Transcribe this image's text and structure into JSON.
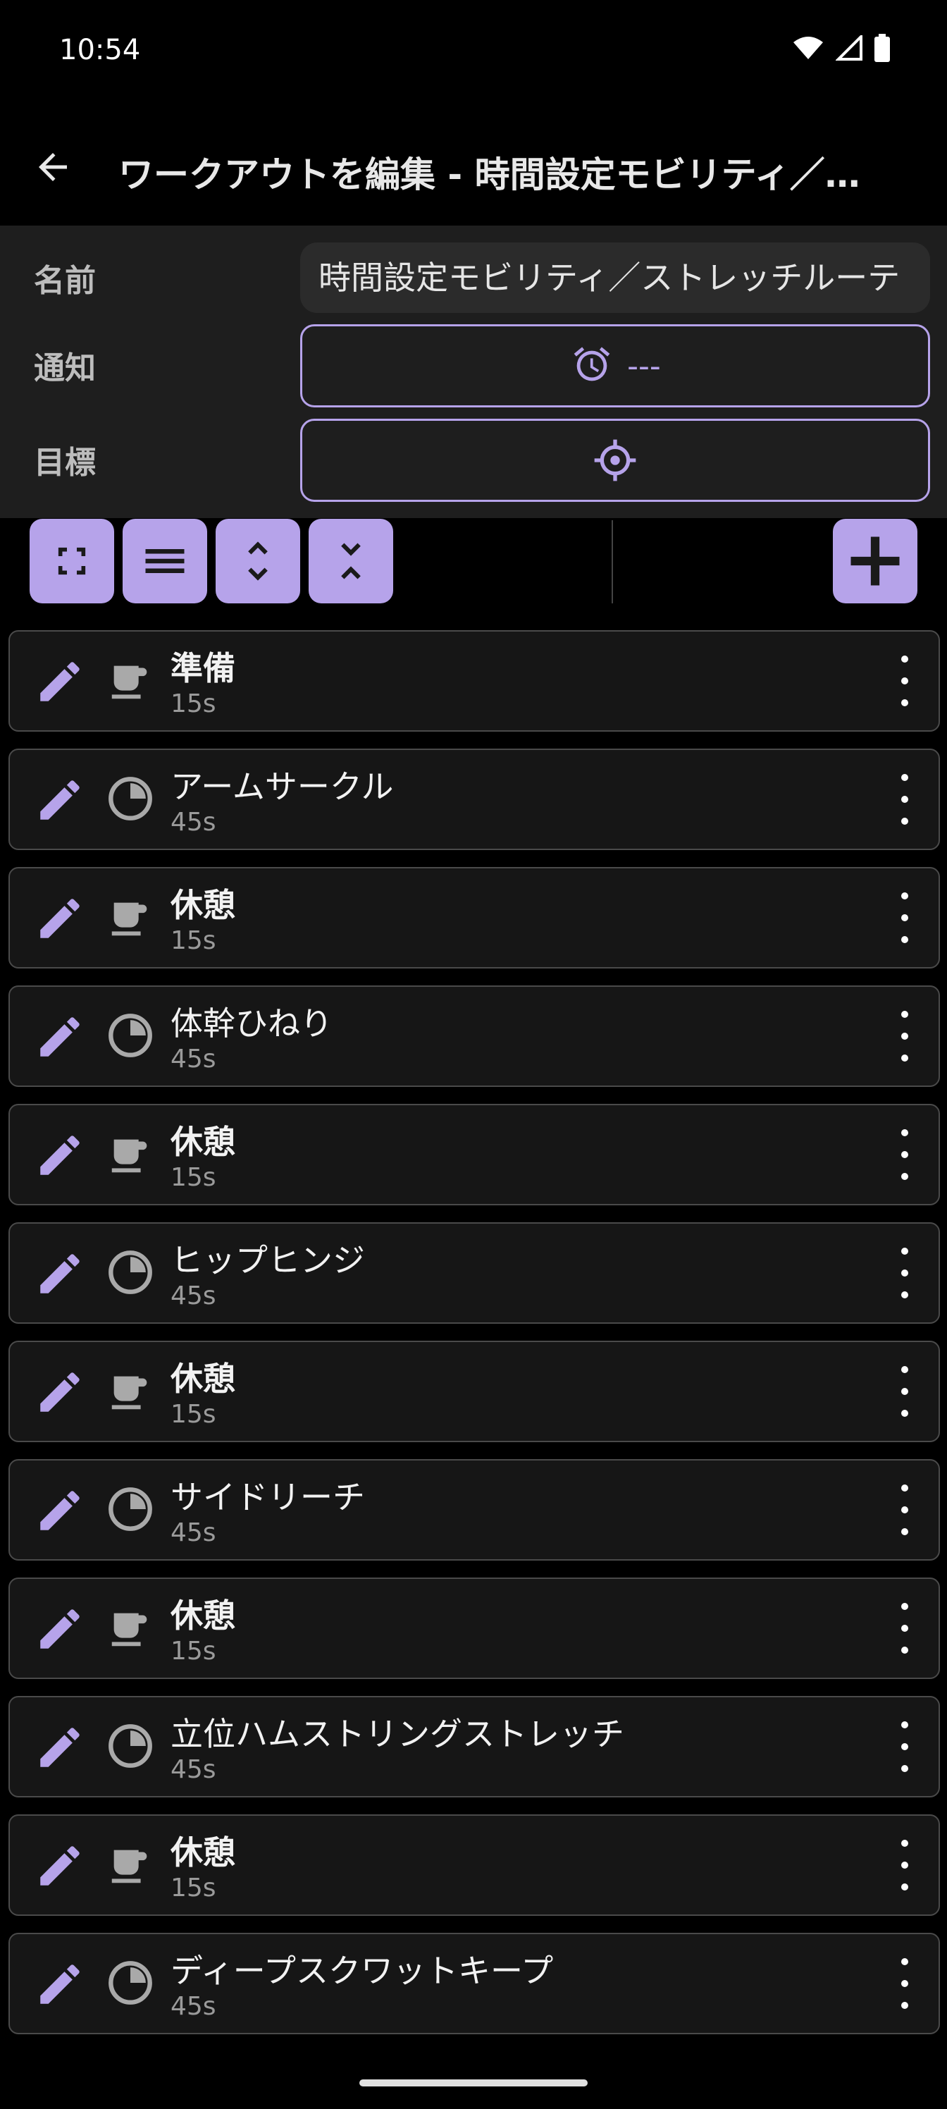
{
  "status": {
    "time": "10:54",
    "icons": [
      "wifi-icon",
      "signal-icon",
      "battery-icon"
    ]
  },
  "app_bar": {
    "title": "ワークアウトを編集 - 時間設定モビリティ／…",
    "back_icon": "arrow-back-icon"
  },
  "form": {
    "name_label": "名前",
    "name_value": "時間設定モビリティ／ストレッチルーテ",
    "notify_label": "通知",
    "notify_value": "---",
    "goal_label": "目標"
  },
  "toolbar": {
    "icons": [
      "fullscreen-icon",
      "menu-icon",
      "expand-icon",
      "collapse-icon",
      "add-icon"
    ]
  },
  "colors": {
    "accent": "#b6a3ea",
    "panel": "#1e1e1e",
    "card": "#161616"
  },
  "items": [
    {
      "name": "準備",
      "duration": "15s",
      "type": "rest",
      "bold": true
    },
    {
      "name": "アームサークル",
      "duration": "45s",
      "type": "timer",
      "bold": false
    },
    {
      "name": "休憩",
      "duration": "15s",
      "type": "rest",
      "bold": true
    },
    {
      "name": "体幹ひねり",
      "duration": "45s",
      "type": "timer",
      "bold": false
    },
    {
      "name": "休憩",
      "duration": "15s",
      "type": "rest",
      "bold": true
    },
    {
      "name": "ヒップヒンジ",
      "duration": "45s",
      "type": "timer",
      "bold": false
    },
    {
      "name": "休憩",
      "duration": "15s",
      "type": "rest",
      "bold": true
    },
    {
      "name": "サイドリーチ",
      "duration": "45s",
      "type": "timer",
      "bold": false
    },
    {
      "name": "休憩",
      "duration": "15s",
      "type": "rest",
      "bold": true
    },
    {
      "name": "立位ハムストリングストレッチ",
      "duration": "45s",
      "type": "timer",
      "bold": false
    },
    {
      "name": "休憩",
      "duration": "15s",
      "type": "rest",
      "bold": true
    },
    {
      "name": "ディープスクワットキープ",
      "duration": "45s",
      "type": "timer",
      "bold": false
    }
  ]
}
